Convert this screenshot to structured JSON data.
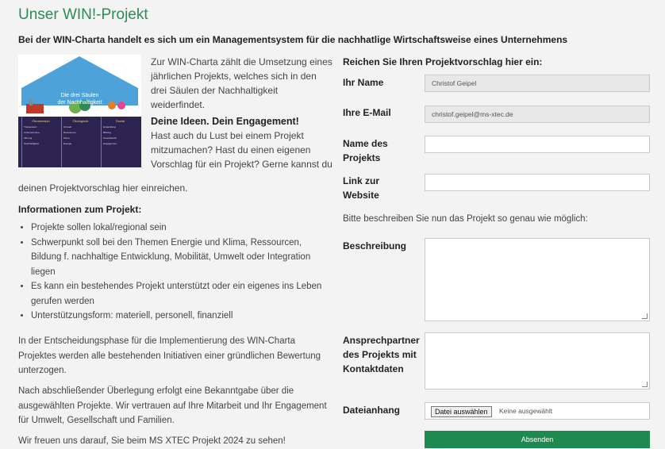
{
  "page": {
    "title": "Unser WIN!-Projekt",
    "subtitle": "Bei der WIN-Charta handelt es sich um ein Managementsystem für die nachhatlige Wirtschaftsweise eines Unternehmens"
  },
  "infographic": {
    "heading_line1": "Die drei Säulen",
    "heading_line2": "der Nachhaltigkeit",
    "pillars": [
      {
        "title": "Ökonomisch",
        "lines": [
          "Transparenz",
          "Unternehmens-",
          "führung",
          "Nachhaltigkeit"
        ]
      },
      {
        "title": "Ökologisch",
        "lines": [
          "Umwelt",
          "Ressourcen",
          "Klima",
          "Energie"
        ]
      },
      {
        "title": "Sozial",
        "lines": [
          "Entwicklung",
          "Bildung",
          "Gesellschaft",
          "Engagement"
        ]
      }
    ]
  },
  "intro": {
    "text1": "Zur WIN-Charta zählt die Umsetzung eines jährlichen Projekts, welches sich in den drei Säulen der Nachhaltigkeit weiderfindet.",
    "heading": "Deine Ideen. Dein Engagement!",
    "text2": "Hast auch du Lust bei einem Projekt mitzumachen? Hast du einen eigenen Vorschlag für ein Projekt? Gerne kannst du",
    "text3": "deinen Projektvorschlag hier einreichen."
  },
  "info": {
    "heading": "Informationen zum Projekt:",
    "bullets": [
      "Projekte sollen lokal/regional sein",
      "Schwerpunkt soll bei den Themen Energie und Klima, Ressourcen, Bildung f. nachhaltige Entwicklung, Mobilität, Umwelt oder Integration liegen",
      "Es kann ein bestehendes Projekt unterstützt oder ein eigenes ins Leben gerufen werden",
      "Unterstützungsform: materiell, personell, finanziell"
    ],
    "para1": "In der Entscheidungsphase für die Implementierung des WIN-Charta Projektes werden alle bestehenden Initiativen einer gründlichen Bewertung unterzogen.",
    "para2": "Nach abschließender Überlegung erfolgt eine Bekanntgabe über die ausgewählten Projekte. Wir vertrauen auf Ihre Mitarbeit und Ihr Engagement für Umwelt, Gesellschaft und Familien.",
    "para3": "Wir freuen uns darauf, Sie beim MS XTEC Projekt 2024 zu sehen!"
  },
  "form": {
    "heading": "Reichen Sie Ihren Projektvorschlag hier ein:",
    "name_label": "Ihr Name",
    "name_value": "Christof Geipel",
    "email_label": "Ihre E-Mail",
    "email_value": "christof.geipel@ms-xtec.de",
    "project_label": "Name des Projekts",
    "link_label": "Link zur Website",
    "hint": "Bitte beschreiben Sie nun das Projekt so genau wie möglich:",
    "description_label": "Beschreibung",
    "contact_label": "Ansprechpartner des Projekts mit Kontaktdaten",
    "file_label": "Dateianhang",
    "file_button": "Datei auswählen",
    "file_none": "Keine ausgewählt",
    "submit": "Absenden"
  },
  "colors": {
    "accent": "#2e8b57",
    "submit": "#1f8a50",
    "infographic_bg": "#2d2350"
  }
}
